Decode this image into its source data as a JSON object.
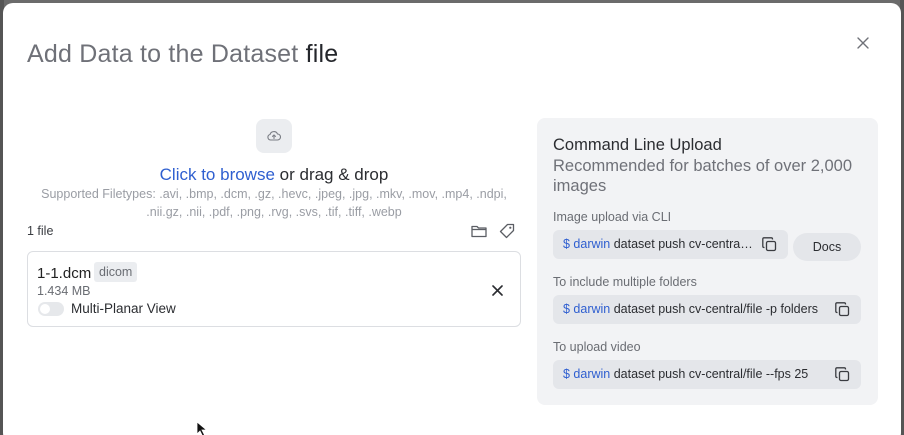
{
  "modal": {
    "title_prefix": "Add Data to the Dataset",
    "title_dataset": "file"
  },
  "upload": {
    "browse_link": "Click to browse",
    "browse_rest": " or drag & drop",
    "filetypes_line1": "Supported Filetypes: .avi, .bmp, .dcm, .gz, .hevc, .jpeg, .jpg, .mkv, .mov, .mp4, .ndpi,",
    "filetypes_line2": ".nii.gz, .nii, .pdf, .png, .rvg, .svs, .tif, .tiff, .webp",
    "file_count": "1 file"
  },
  "files": [
    {
      "name": "1-1.dcm",
      "badge": "dicom",
      "size": "1.434 MB",
      "toggle_label": "Multi-Planar View",
      "toggle_on": false
    }
  ],
  "cli": {
    "title": "Command Line Upload",
    "subtitle": "Recommended for batches of over 2,000 images",
    "docs_label": "Docs",
    "sections": [
      {
        "label": "Image upload via CLI",
        "prompt": "$ darwin",
        "command": " dataset push cv-central/file"
      },
      {
        "label": "To include multiple folders",
        "prompt": "$ darwin",
        "command": " dataset push cv-central/file -p folders"
      },
      {
        "label": "To upload video",
        "prompt": "$ darwin",
        "command": " dataset push cv-central/file --fps 25"
      }
    ]
  },
  "icons": {
    "close": "close-icon",
    "upload": "cloud-upload-icon",
    "folder": "folder-icon",
    "tag": "tag-icon",
    "remove": "remove-icon",
    "copy": "copy-icon"
  },
  "colors": {
    "link": "#2f5fd0",
    "panel_bg": "#f2f3f5",
    "command_bg": "#e4e6ea"
  }
}
